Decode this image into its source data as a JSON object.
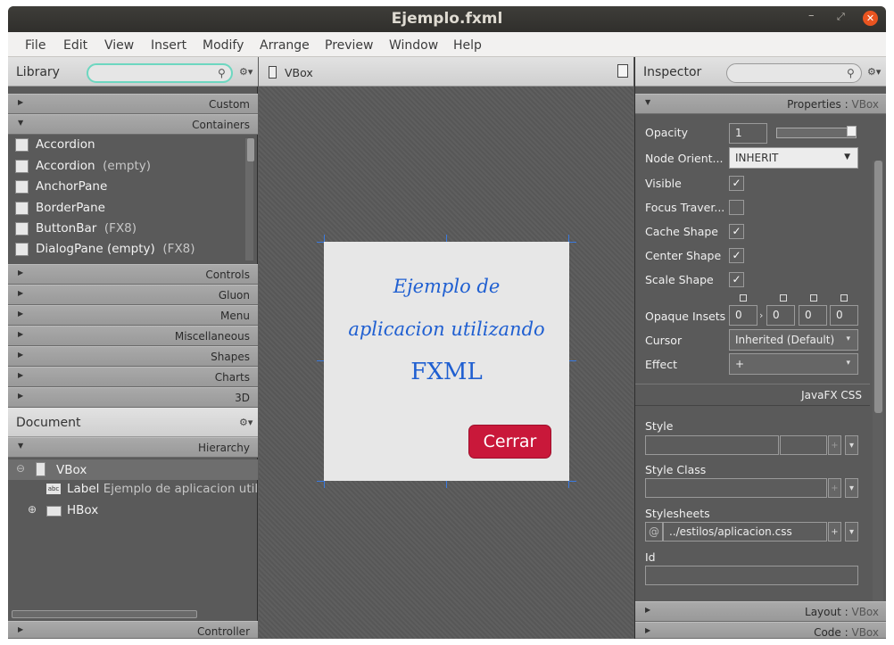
{
  "window": {
    "title": "Ejemplo.fxml",
    "min_glyph": "–",
    "max_glyph": "⤢",
    "close_glyph": "✕"
  },
  "menu": [
    "File",
    "Edit",
    "View",
    "Insert",
    "Modify",
    "Arrange",
    "Preview",
    "Window",
    "Help"
  ],
  "library": {
    "title": "Library",
    "search_value": "",
    "sections": {
      "custom": "Custom",
      "containers": "Containers",
      "controls": "Controls",
      "gluon": "Gluon",
      "menu": "Menu",
      "misc": "Miscellaneous",
      "shapes": "Shapes",
      "charts": "Charts",
      "3d": "3D"
    },
    "items": [
      {
        "name": "Accordion",
        "sub": ""
      },
      {
        "name": "Accordion",
        "sub": "(empty)"
      },
      {
        "name": "AnchorPane",
        "sub": ""
      },
      {
        "name": "BorderPane",
        "sub": ""
      },
      {
        "name": "ButtonBar",
        "sub": "(FX8)"
      },
      {
        "name": "DialogPane (empty)",
        "sub": "(FX8)"
      }
    ]
  },
  "document": {
    "title": "Document",
    "hierarchy_label": "Hierarchy",
    "nodes": {
      "vbox": "VBox",
      "label_type": "Label",
      "label_text": "Ejemplo de aplicacion utili",
      "hbox": "HBox",
      "label_icon": "abc"
    },
    "controller_label": "Controller"
  },
  "center": {
    "breadcrumb": "VBox",
    "scene": {
      "line1": "Ejemplo de",
      "line2": "aplicacion utilizando",
      "line3": "FXML",
      "button": "Cerrar"
    }
  },
  "inspector": {
    "title": "Inspector",
    "properties_header": "Properties",
    "properties_target": "VBox",
    "opacity_label": "Opacity",
    "opacity_value": "1",
    "node_orient_label": "Node Orient...",
    "node_orient_value": "INHERIT",
    "visible_label": "Visible",
    "focus_label": "Focus Traver...",
    "cache_label": "Cache Shape",
    "center_label": "Center Shape",
    "scale_label": "Scale Shape",
    "insets_label": "Opaque Insets",
    "insets": [
      "0",
      "0",
      "0",
      "0"
    ],
    "cursor_label": "Cursor",
    "cursor_value": "Inherited (Default)",
    "effect_label": "Effect",
    "effect_value": "+",
    "css_header": "JavaFX CSS",
    "style_label": "Style",
    "style_class_label": "Style Class",
    "stylesheets_label": "Stylesheets",
    "stylesheet_value": "../estilos/aplicacion.css",
    "id_label": "Id",
    "layout_header": "Layout",
    "code_header": "Code"
  }
}
